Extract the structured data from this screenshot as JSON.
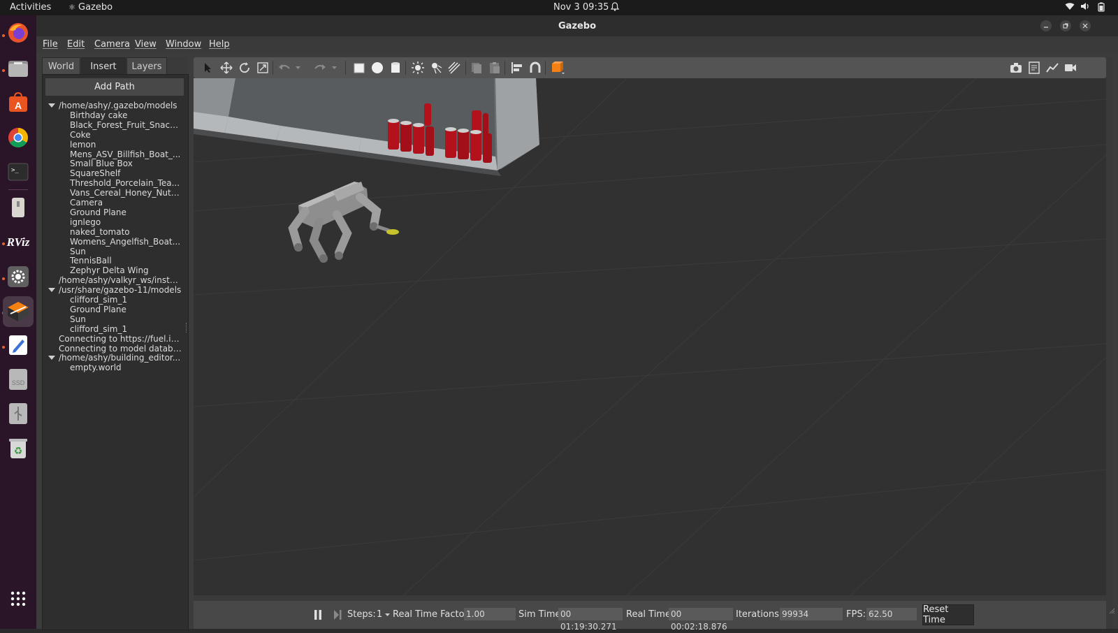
{
  "topbar": {
    "activities": "Activities",
    "app_name": "Gazebo",
    "datetime": "Nov 3  09:35"
  },
  "window": {
    "title": "Gazebo"
  },
  "menu": [
    "File",
    "Edit",
    "Camera",
    "View",
    "Window",
    "Help"
  ],
  "tabs": [
    "World",
    "Insert",
    "Layers"
  ],
  "active_tab": "Insert",
  "insert_panel": {
    "add_path_label": "Add Path",
    "tree": [
      {
        "label": "/home/ashy/.gazebo/models",
        "level": 0,
        "expanded": true
      },
      {
        "label": "Birthday cake",
        "level": 1
      },
      {
        "label": "Black_Forest_Fruit_Snack...",
        "level": 1
      },
      {
        "label": "Coke",
        "level": 1
      },
      {
        "label": "lemon",
        "level": 1
      },
      {
        "label": "Mens_ASV_Billfish_Boat_...",
        "level": 1
      },
      {
        "label": "Small Blue Box",
        "level": 1
      },
      {
        "label": "SquareShelf",
        "level": 1
      },
      {
        "label": "Threshold_Porcelain_Tea...",
        "level": 1
      },
      {
        "label": "Vans_Cereal_Honey_Nut_...",
        "level": 1
      },
      {
        "label": "Camera",
        "level": 1
      },
      {
        "label": "Ground Plane",
        "level": 1
      },
      {
        "label": "ignlego",
        "level": 1
      },
      {
        "label": "naked_tomato",
        "level": 1
      },
      {
        "label": "Womens_Angelfish_Boat...",
        "level": 1
      },
      {
        "label": "Sun",
        "level": 1
      },
      {
        "label": "TennisBall",
        "level": 1
      },
      {
        "label": "Zephyr Delta Wing",
        "level": 1
      },
      {
        "label": "/home/ashy/valkyr_ws/instal...",
        "level": 0,
        "expanded": false
      },
      {
        "label": "/usr/share/gazebo-11/models",
        "level": 0,
        "expanded": true
      },
      {
        "label": "clifford_sim_1",
        "level": 1
      },
      {
        "label": "Ground Plane",
        "level": 1
      },
      {
        "label": "Sun",
        "level": 1
      },
      {
        "label": "clifford_sim_1",
        "level": 1
      },
      {
        "label": "Connecting to https://fuel.ig...",
        "level": 0,
        "expanded": false
      },
      {
        "label": "Connecting to model databa...",
        "level": 0,
        "expanded": false
      },
      {
        "label": "/home/ashy/building_editor...",
        "level": 0,
        "expanded": true
      },
      {
        "label": "empty.world",
        "level": 1
      }
    ]
  },
  "statusbar": {
    "steps_label": "Steps:",
    "steps_value": "1",
    "rtf_label": "Real Time Factor:",
    "rtf_value": "1.00",
    "sim_time_label": "Sim Time:",
    "sim_time_value": "00 01:19:30.271",
    "real_time_label": "Real Time:",
    "real_time_value": "00 00:02:18.876",
    "iterations_label": "Iterations:",
    "iterations_value": "99934",
    "fps_label": "FPS:",
    "fps_value": "62.50",
    "reset_label": "Reset Time"
  },
  "colors": {
    "accent": "#e5622d",
    "viewport_bg": "#313131",
    "can_red": "#b3121c"
  },
  "dock_icons": [
    "firefox-icon",
    "files-icon",
    "software-icon",
    "chrome-icon",
    "terminal-icon",
    "usb-drive-icon",
    "rviz-icon",
    "settings-icon",
    "gazebo-icon",
    "text-editor-icon",
    "ssd-icon",
    "usb-icon",
    "trash-icon",
    "app-grid-icon"
  ]
}
